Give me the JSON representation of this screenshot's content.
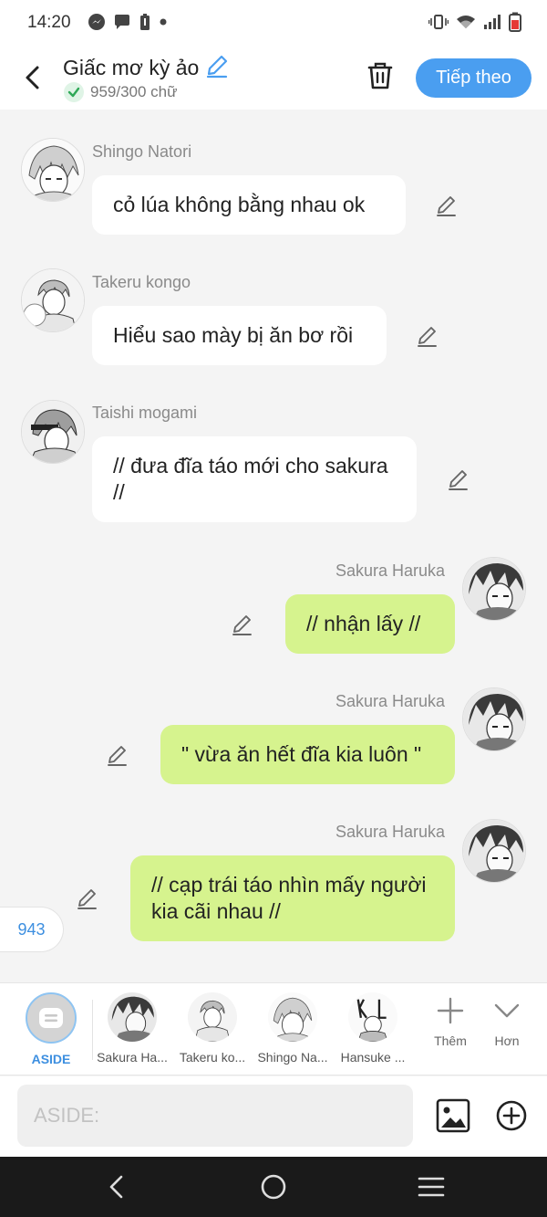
{
  "status_bar": {
    "time": "14:20",
    "left_icons": [
      "messenger-icon",
      "chat-bubble-icon",
      "battery-saver-icon",
      "dot-icon"
    ],
    "right_icons": [
      "vibrate-icon",
      "wifi-icon",
      "signal-icon",
      "battery-icon"
    ]
  },
  "header": {
    "title": "Giấc mơ kỳ ảo",
    "word_count": "959/300 chữ",
    "next_label": "Tiếp theo",
    "accent_color": "#4a9ef0"
  },
  "messages": [
    {
      "sender": "Shingo Natori",
      "text": "cỏ lúa không bằng nhau ok",
      "side": "left"
    },
    {
      "sender": "Takeru kongo",
      "text": "Hiểu sao mày bị ăn bơ rồi",
      "side": "left"
    },
    {
      "sender": "Taishi mogami",
      "text": "// đưa đĩa táo mới cho sakura //",
      "side": "left"
    },
    {
      "sender": "Sakura Haruka",
      "text": "// nhận lấy //",
      "side": "right"
    },
    {
      "sender": "Sakura Haruka",
      "text": "\" vừa ăn hết đĩa kia luôn \"",
      "side": "right"
    },
    {
      "sender": "Sakura Haruka",
      "text": "// cạp trái táo nhìn mấy người kia cãi nhau //",
      "side": "right"
    }
  ],
  "count_badge": "943",
  "characters": {
    "aside_label": "ASIDE",
    "items": [
      {
        "name": "Sakura Ha..."
      },
      {
        "name": "Takeru ko..."
      },
      {
        "name": "Shingo Na..."
      },
      {
        "name": "Hansuke ..."
      }
    ],
    "more_label": "Thêm",
    "expand_label": "Hơn"
  },
  "input": {
    "placeholder": "ASIDE:"
  }
}
